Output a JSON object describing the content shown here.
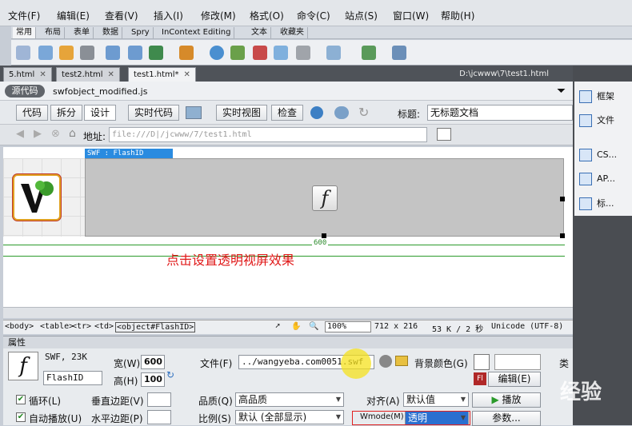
{
  "menu": [
    "文件(F)",
    "编辑(E)",
    "查看(V)",
    "插入(I)",
    "修改(M)",
    "格式(O)",
    "命令(C)",
    "站点(S)",
    "窗口(W)",
    "帮助(H)"
  ],
  "insert_tabs": [
    "常用",
    "布局",
    "表单",
    "数据",
    "Spry",
    "InContext Editing",
    "文本",
    "收藏夹"
  ],
  "doc_tabs": [
    {
      "label": "5.html"
    },
    {
      "label": "test2.html"
    },
    {
      "label": "test1.html*"
    }
  ],
  "doc_path": "D:\\jcwww\\7\\test1.html",
  "related": {
    "source_label": "源代码",
    "file": "swfobject_modified.js"
  },
  "doc_toolbar": {
    "code": "代码",
    "split": "拆分",
    "design": "设计",
    "live_code": "实时代码",
    "live_view": "实时视图",
    "inspect": "检查",
    "title_label": "标题:",
    "title_value": "无标题文档"
  },
  "address": {
    "label": "地址:",
    "value": "file:///D|/jcwww/7/test1.html"
  },
  "design": {
    "swf_label": "SWF : FlashID",
    "ruler_width": "600",
    "annotation": "点击设置透明视屏效果"
  },
  "status": {
    "tags": [
      "<body>",
      "<table>",
      "<tr>",
      "<td>",
      "<object#FlashID>"
    ],
    "zoom": "100%",
    "size": "712 x 216",
    "weight": "53 K / 2 秒",
    "encoding": "Unicode (UTF-8)"
  },
  "props": {
    "header": "属性",
    "type": "SWF, 23K",
    "id": "FlashID",
    "width_label": "宽(W)",
    "width": "600",
    "height_label": "高(H)",
    "height": "100",
    "file_label": "文件(F)",
    "file": "../wangyeba.com0051.swf",
    "bg_label": "背景颜色(G)",
    "class_label": "类",
    "edit_label": "编辑(E)",
    "loop_label": "循环(L)",
    "autoplay_label": "自动播放(U)",
    "vspace_label": "垂直边距(V)",
    "hspace_label": "水平边距(P)",
    "quality_label": "品质(Q)",
    "quality": "高品质",
    "scale_label": "比例(S)",
    "scale": "默认 (全部显示)",
    "align_label": "对齐(A)",
    "align": "默认值",
    "wmode_label": "Wmode(M)",
    "wmode": "透明",
    "play_label": "播放",
    "params_label": "参数..."
  },
  "right_panel": [
    "框架",
    "文件",
    "CS...",
    "AP...",
    "标..."
  ],
  "watermark": "经验"
}
